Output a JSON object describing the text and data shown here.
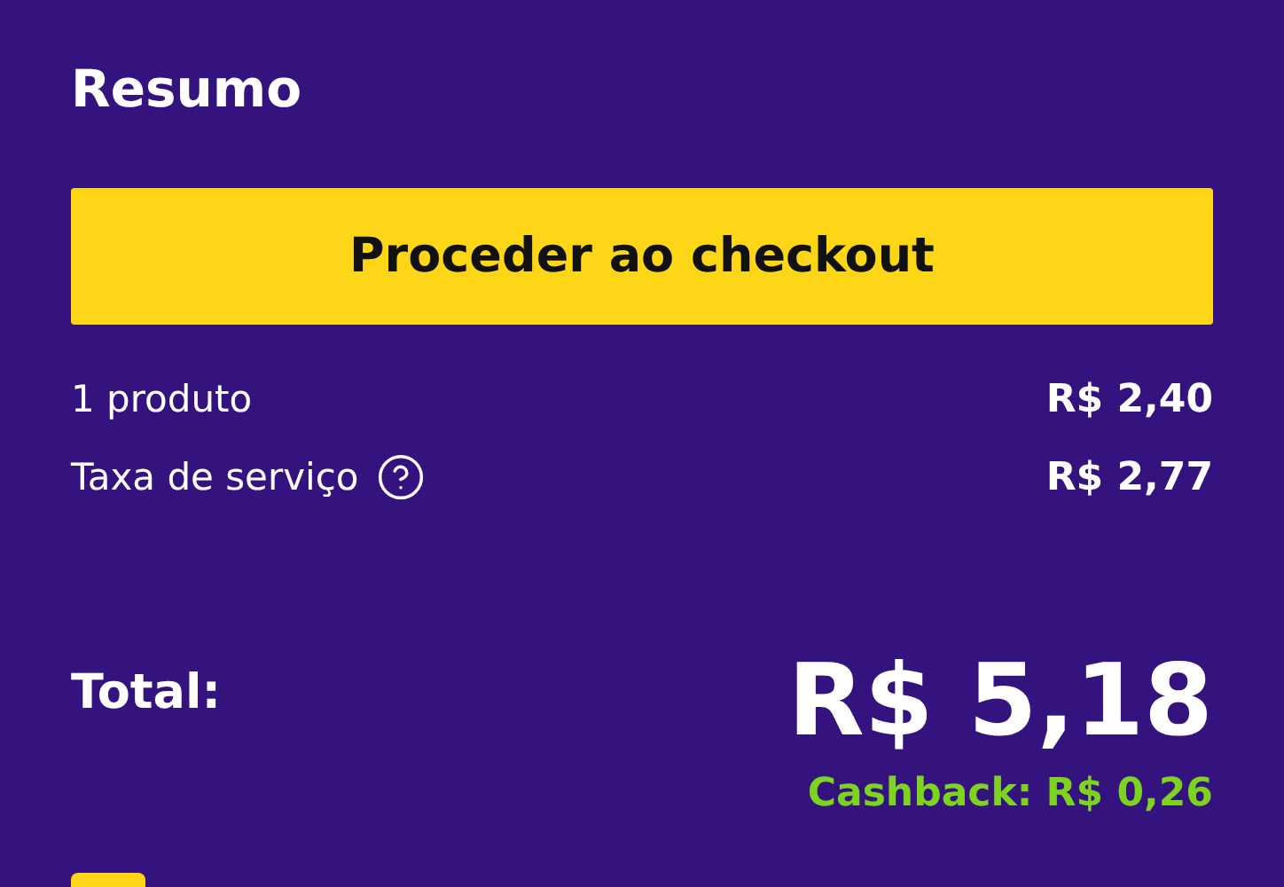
{
  "summary": {
    "title": "Resumo",
    "checkout_button": "Proceder ao checkout",
    "lines": [
      {
        "label": "1 produto",
        "value": "R$ 2,40",
        "help": false
      },
      {
        "label": "Taxa de serviço",
        "value": "R$ 2,77",
        "help": true
      }
    ],
    "total_label": "Total:",
    "total_value": "R$ 5,18",
    "cashback": "Cashback: R$ 0,26"
  }
}
